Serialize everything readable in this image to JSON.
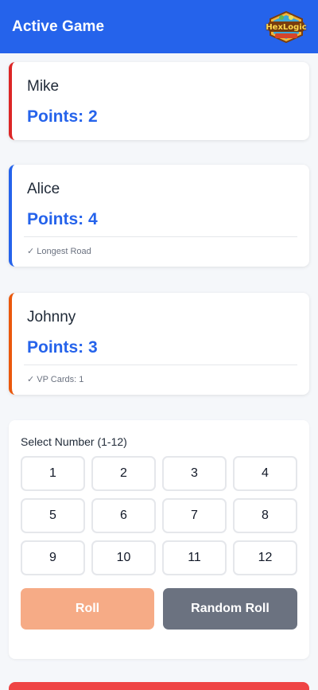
{
  "header": {
    "title": "Active Game",
    "logo_text": "HexLogic"
  },
  "players": [
    {
      "name": "Mike",
      "points_label": "Points: 2",
      "note": "",
      "accent": "#dc2626"
    },
    {
      "name": "Alice",
      "points_label": "Points: 4",
      "note": "✓ Longest Road",
      "accent": "#2563eb"
    },
    {
      "name": "Johnny",
      "points_label": "Points: 3",
      "note": "✓ VP Cards: 1",
      "accent": "#ea580c"
    }
  ],
  "selector": {
    "label": "Select Number (1-12)",
    "numbers": [
      "1",
      "2",
      "3",
      "4",
      "5",
      "6",
      "7",
      "8",
      "9",
      "10",
      "11",
      "12"
    ],
    "roll_label": "Roll",
    "random_roll_label": "Random Roll"
  },
  "colors": {
    "header_bg": "#2563eb",
    "points_text": "#2563eb",
    "roll_button": "#f6ab86",
    "random_roll_button": "#6b7280",
    "bottom_button": "#ef4444"
  }
}
